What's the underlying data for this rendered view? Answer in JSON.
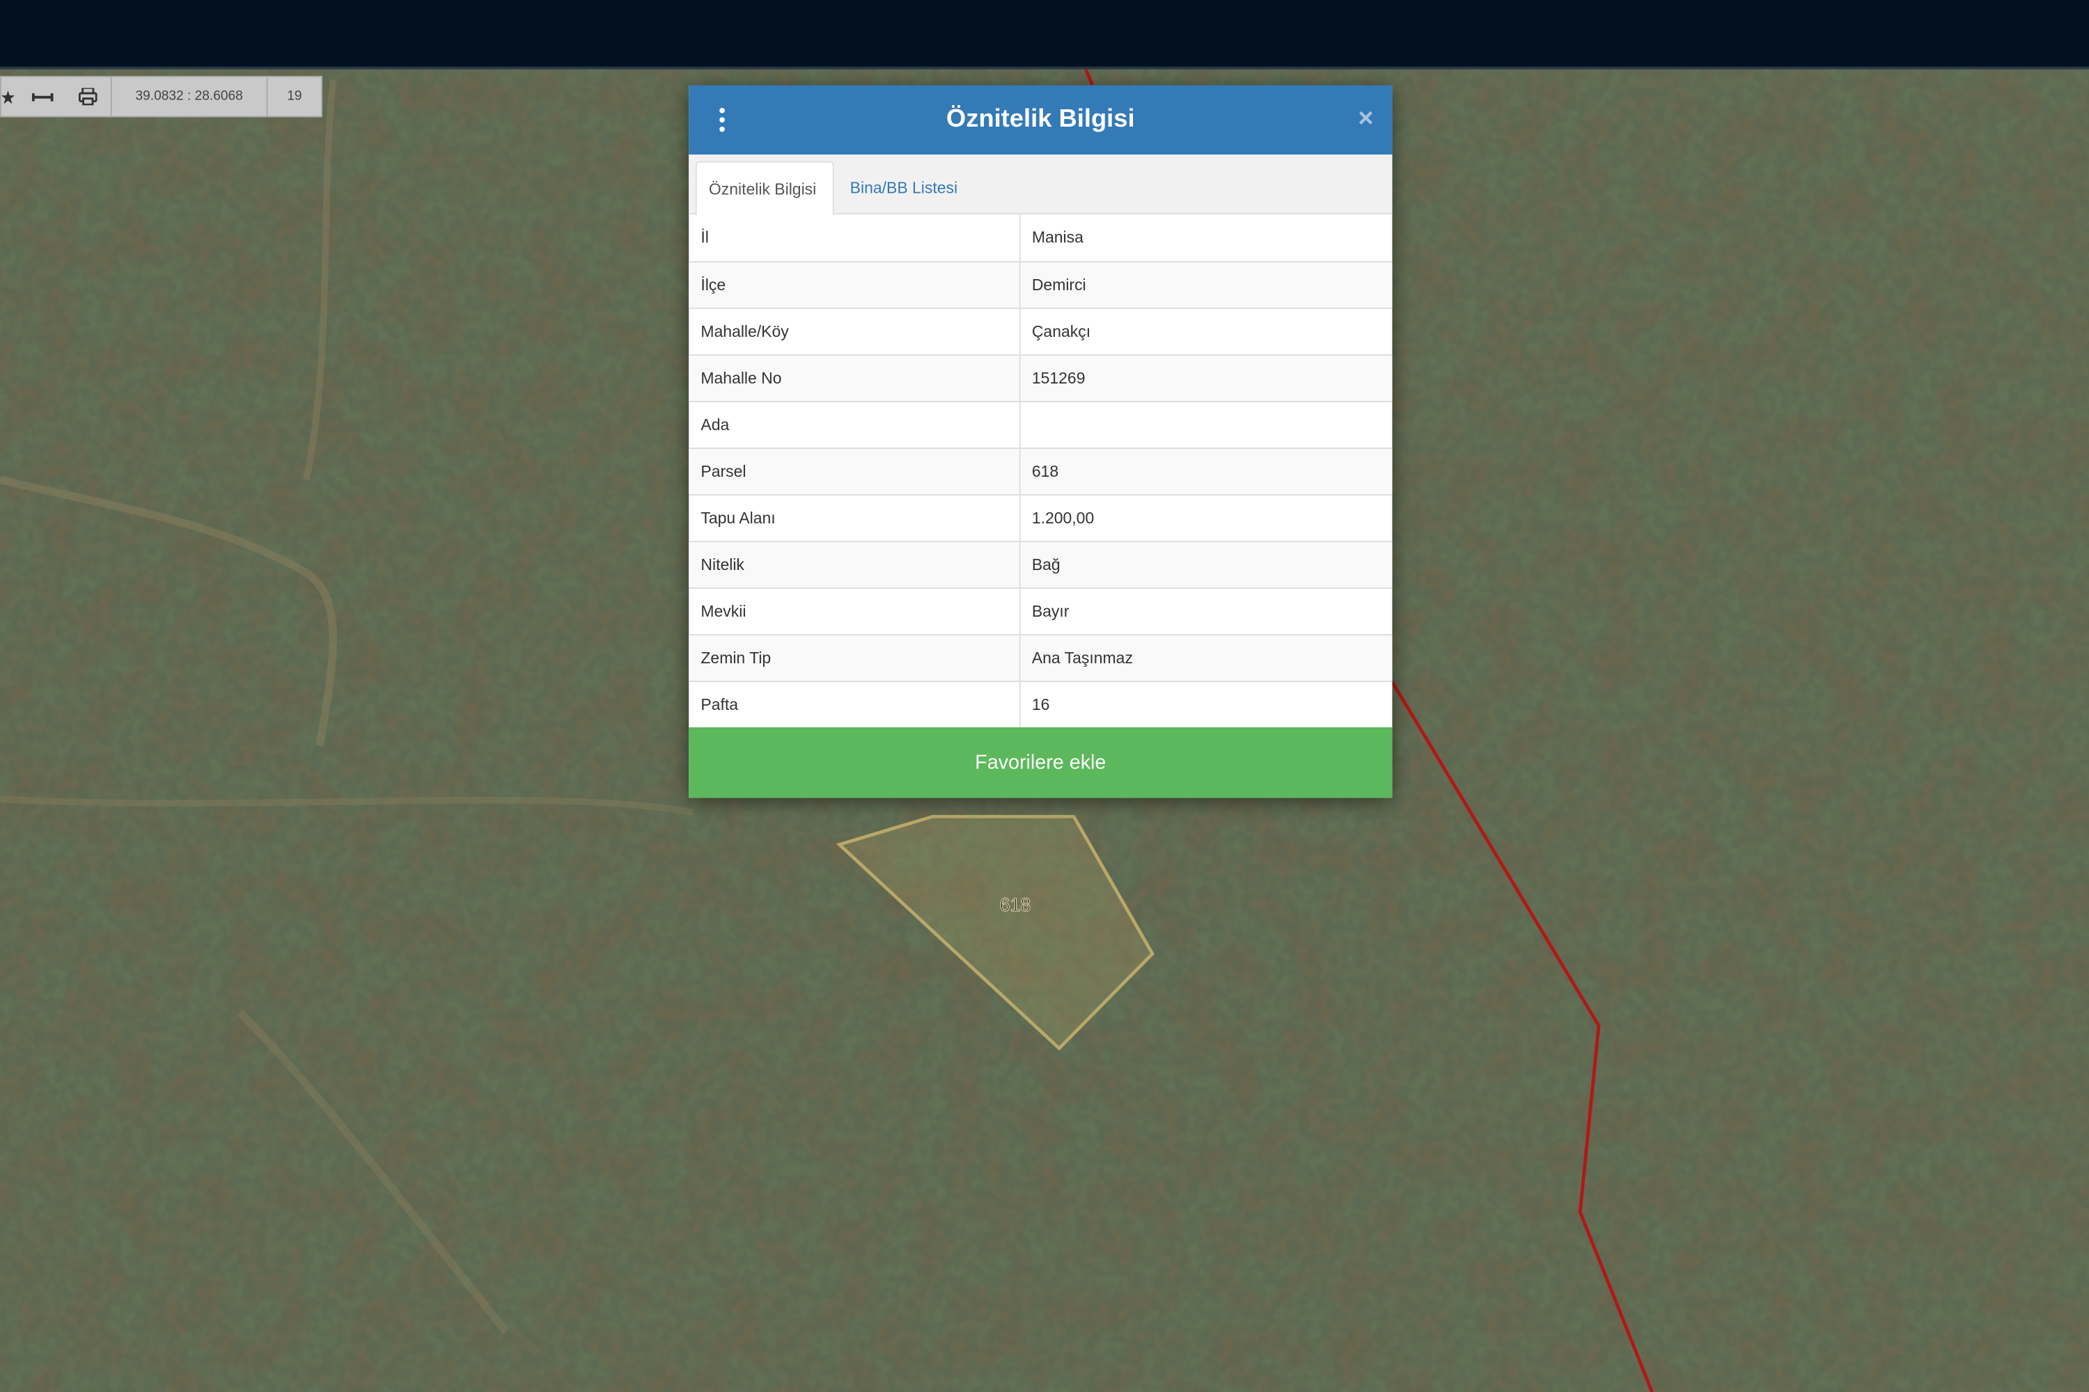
{
  "toolbar": {
    "coords": "39.0832 : 28.6068",
    "zoom": "19",
    "icons": [
      "star-icon",
      "measure-icon",
      "print-icon"
    ]
  },
  "modal": {
    "title": "Öznitelik Bilgisi",
    "close": "×",
    "tabs": [
      {
        "label": "Öznitelik Bilgisi",
        "active": true
      },
      {
        "label": "Bina/BB Listesi",
        "active": false
      }
    ],
    "rows": [
      {
        "key": "İl",
        "value": "Manisa"
      },
      {
        "key": "İlçe",
        "value": "Demirci"
      },
      {
        "key": "Mahalle/Köy",
        "value": "Çanakçı"
      },
      {
        "key": "Mahalle No",
        "value": "151269"
      },
      {
        "key": "Ada",
        "value": ""
      },
      {
        "key": "Parsel",
        "value": "618"
      },
      {
        "key": "Tapu Alanı",
        "value": "1.200,00"
      },
      {
        "key": "Nitelik",
        "value": "Bağ"
      },
      {
        "key": "Mevkii",
        "value": "Bayır"
      },
      {
        "key": "Zemin Tip",
        "value": "Ana Taşınmaz"
      },
      {
        "key": "Pafta",
        "value": "16"
      }
    ],
    "favorite_button": "Favorilere ekle"
  },
  "map": {
    "parcel_label": "618",
    "parcel_color": "#b8a86a",
    "boundary_color": "#b01818"
  }
}
